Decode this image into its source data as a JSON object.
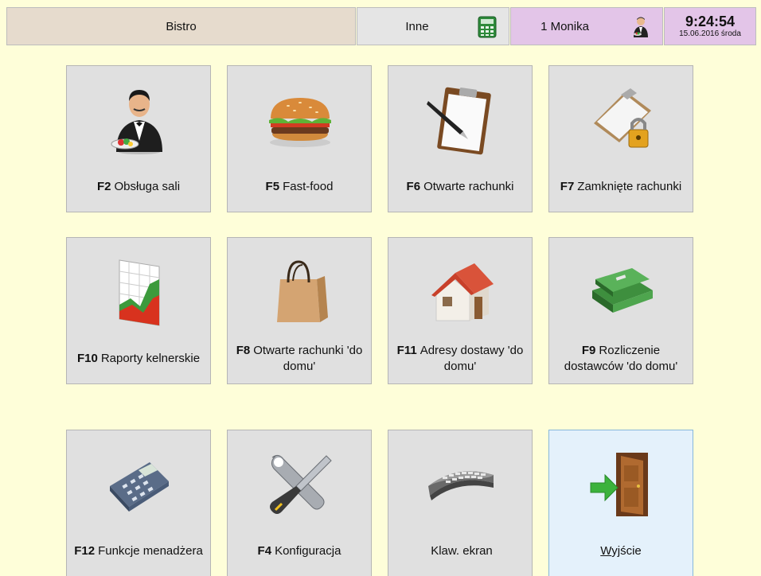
{
  "header": {
    "venue": "Bistro",
    "other": "Inne",
    "user": "1 Monika",
    "time": "9:24:54",
    "date": "15.06.2016 środa"
  },
  "tiles": [
    {
      "key": "F2",
      "label": "Obsługa sali",
      "icon": "waiter-icon"
    },
    {
      "key": "F5",
      "label": "Fast-food",
      "icon": "burger-icon"
    },
    {
      "key": "F6",
      "label": "Otwarte rachunki",
      "icon": "clipboard-pen-icon"
    },
    {
      "key": "F7",
      "label": "Zamknięte rachunki",
      "icon": "clipboard-lock-icon"
    },
    {
      "key": "F10",
      "label": "Raporty kelnerskie",
      "icon": "chart-icon"
    },
    {
      "key": "F8",
      "label": "Otwarte rachunki 'do domu'",
      "icon": "shopping-bag-icon"
    },
    {
      "key": "F11",
      "label": "Adresy dostawy 'do domu'",
      "icon": "house-icon"
    },
    {
      "key": "F9",
      "label": "Rozliczenie dostawców 'do domu'",
      "icon": "money-icon"
    },
    {
      "key": "F12",
      "label": "Funkcje menadżera",
      "icon": "calculator-icon"
    },
    {
      "key": "F4",
      "label": "Konfiguracja",
      "icon": "tools-icon"
    },
    {
      "key": "",
      "label": "Klaw. ekran",
      "icon": "keyboard-icon"
    },
    {
      "key": "",
      "label": "Wyjście",
      "icon": "exit-door-icon",
      "underline_first": "W",
      "rest": "yjście"
    }
  ]
}
